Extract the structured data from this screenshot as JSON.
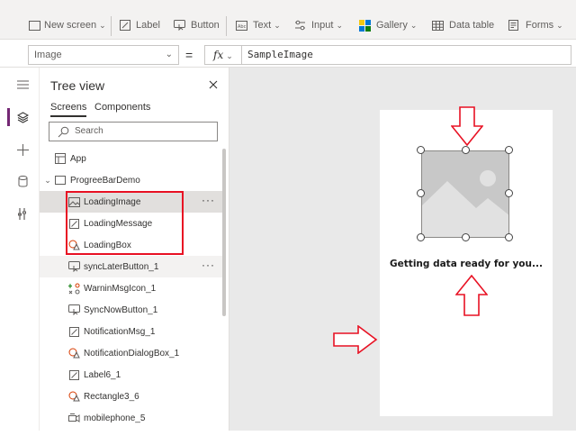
{
  "ribbon": {
    "items": [
      {
        "label": "New screen",
        "icon": "screen-icon",
        "has_dropdown": true
      },
      {
        "label": "Label",
        "icon": "label-pencil-icon",
        "has_dropdown": false
      },
      {
        "label": "Button",
        "icon": "button-cursor-icon",
        "has_dropdown": false
      },
      {
        "label": "Text",
        "icon": "text-abc-icon",
        "has_dropdown": true
      },
      {
        "label": "Input",
        "icon": "input-sliders-icon",
        "has_dropdown": true
      },
      {
        "label": "Gallery",
        "icon": "gallery-grid-icon",
        "has_dropdown": true
      },
      {
        "label": "Data table",
        "icon": "table-icon",
        "has_dropdown": false
      },
      {
        "label": "Forms",
        "icon": "forms-icon",
        "has_dropdown": true
      }
    ]
  },
  "formula_bar": {
    "property": "Image",
    "equals": "=",
    "fx": "fx",
    "formula": "SampleImage"
  },
  "rail": [
    "hamburger-icon",
    "layers-icon",
    "plus-icon",
    "database-icon",
    "tools-icon"
  ],
  "tree_view": {
    "title": "Tree view",
    "tabs": [
      {
        "label": "Screens",
        "active": true
      },
      {
        "label": "Components",
        "active": false
      }
    ],
    "search_placeholder": "Search",
    "nodes": [
      {
        "label": "App",
        "icon": "app-icon"
      },
      {
        "label": "ProgreeBarDemo",
        "icon": "screen-icon",
        "expandable": true
      },
      {
        "label": "LoadingImage",
        "icon": "image-icon",
        "selected": true,
        "more": "···"
      },
      {
        "label": "LoadingMessage",
        "icon": "label-pencil-icon"
      },
      {
        "label": "LoadingBox",
        "icon": "shape-icon"
      },
      {
        "label": "syncLaterButton_1",
        "icon": "button-cursor-icon",
        "hover": true,
        "more": "···"
      },
      {
        "label": "WarninMsgIcon_1",
        "icon": "icons-icon"
      },
      {
        "label": "SyncNowButton_1",
        "icon": "button-cursor-icon"
      },
      {
        "label": "NotificationMsg_1",
        "icon": "label-pencil-icon"
      },
      {
        "label": "NotificationDialogBox_1",
        "icon": "shape-icon"
      },
      {
        "label": "Label6_1",
        "icon": "label-pencil-icon"
      },
      {
        "label": "Rectangle3_6",
        "icon": "shape-icon"
      },
      {
        "label": "mobilephone_5",
        "icon": "media-icon"
      }
    ]
  },
  "canvas": {
    "message": "Getting data ready for you...",
    "annotation_color": "#e81123"
  },
  "colors": {
    "accent": "#742774",
    "annotation": "#e81123",
    "canvas_bg": "#e9e9e9"
  }
}
